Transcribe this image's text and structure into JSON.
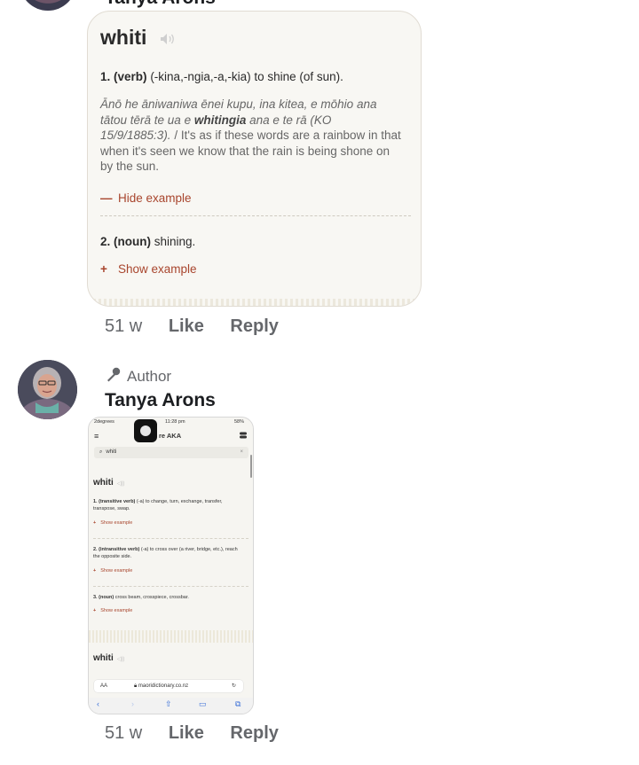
{
  "top_comment": {
    "author_name_partial": "Tanya Arons",
    "card": {
      "word": "whiti",
      "sense1": {
        "num": "1.",
        "pos": "(verb)",
        "text": "(-kina,-ngia,-a,-kia) to shine (of sun)."
      },
      "example": {
        "maori_before": "Ānō he āniwaniwa ēnei kupu, ina kitea, e mōhio ana tātou tērā te ua e ",
        "maori_bold": "whitingia",
        "maori_after": " ana e te rā (KO 15/9/1885:3).",
        "english": " / It's as if these words are a rainbow in that when it's seen we know that the rain is being shone on by the sun."
      },
      "hide_symbol": "—",
      "hide_label": "Hide example",
      "sense2": {
        "num": "2.",
        "pos": "(noun)",
        "text": "shining."
      },
      "show_symbol": "+",
      "show_label": "Show example"
    },
    "meta": {
      "time": "51 w",
      "like": "Like",
      "reply": "Reply"
    }
  },
  "second_comment": {
    "badge_label": "Author",
    "author_name": "Tanya Arons",
    "screenshot": {
      "status_carrier": "2degrees",
      "status_time": "11:28 pm",
      "status_battery": "58%",
      "app_title": "re AKA",
      "search_value": "whiti",
      "entries": [
        {
          "word": "whiti",
          "senses": [
            {
              "num": "1.",
              "pos": "(transitive verb)",
              "text": "(-a) to change, turn, exchange, transfer, transpose, swap."
            },
            {
              "num": "2.",
              "pos": "(intransitive verb)",
              "text": "(-a) to cross over (a river, bridge, etc.), reach the opposite side."
            },
            {
              "num": "3.",
              "pos": "(noun)",
              "text": "cross beam, crosspiece, crossbar."
            }
          ]
        },
        {
          "word": "whiti"
        }
      ],
      "show_label": "Show example",
      "url_aa": "AA",
      "url": "maoridictionary.co.nz"
    },
    "meta": {
      "time": "51 w",
      "like": "Like",
      "reply": "Reply"
    }
  }
}
